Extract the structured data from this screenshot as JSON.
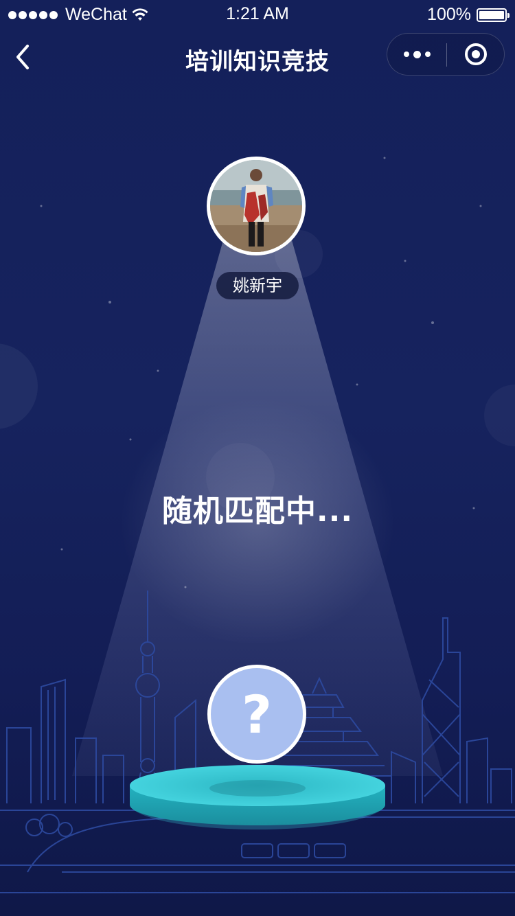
{
  "status_bar": {
    "carrier": "WeChat",
    "time": "1:21 AM",
    "battery": "100%",
    "battery_level": 1.0
  },
  "nav": {
    "title": "培训知识竞技",
    "back_icon": "chevron-left-icon",
    "more_icon": "more-dots-icon",
    "close_icon": "target-circle-icon"
  },
  "player": {
    "name": "姚新宇",
    "avatar_icon": "user-photo-avatar"
  },
  "matching": {
    "status_text": "随机匹配中..."
  },
  "opponent": {
    "placeholder": "?"
  },
  "colors": {
    "background": "#16235e",
    "podium": "#37c6d2",
    "opponent_avatar": "#a9bff0",
    "skyline_line": "#2d4aa0"
  }
}
